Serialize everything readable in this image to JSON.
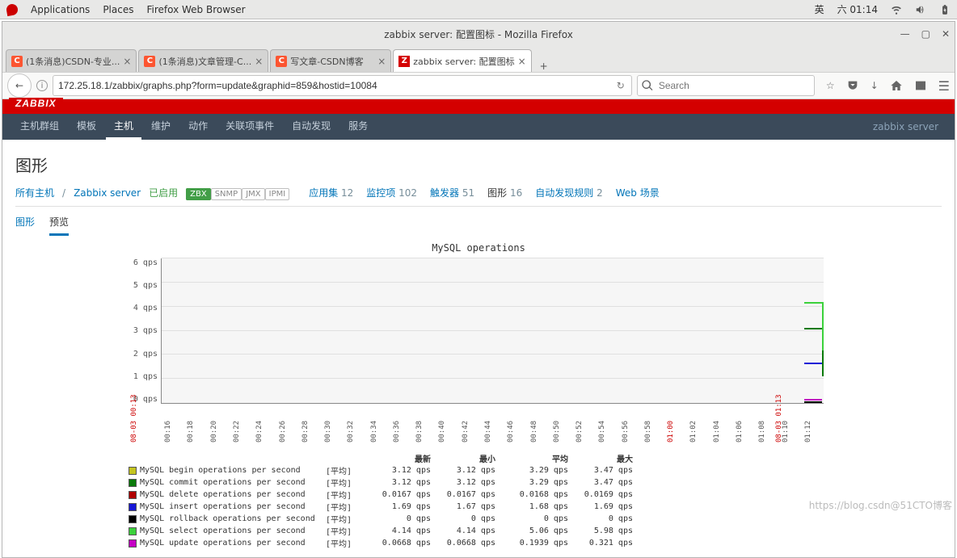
{
  "gnome": {
    "apps": "Applications",
    "places": "Places",
    "browser": "Firefox Web Browser",
    "lang": "英",
    "date": "六 01:14"
  },
  "firefox": {
    "title": "zabbix server: 配置图标 - Mozilla Firefox",
    "url": "172.25.18.1/zabbix/graphs.php?form=update&graphid=859&hostid=10084",
    "search_placeholder": "Search",
    "tabs": [
      {
        "label": "(1条消息)CSDN-专业...",
        "icon": "csdn"
      },
      {
        "label": "(1条消息)文章管理-C...",
        "icon": "csdn"
      },
      {
        "label": "写文章-CSDN博客",
        "icon": "csdn"
      },
      {
        "label": "zabbix server: 配置图标",
        "icon": "zbx",
        "active": true
      }
    ]
  },
  "zabbix": {
    "logo": "ZABBIX",
    "server_name": "zabbix server",
    "nav": [
      {
        "label": "主机群组"
      },
      {
        "label": "模板"
      },
      {
        "label": "主机",
        "active": true
      },
      {
        "label": "维护"
      },
      {
        "label": "动作"
      },
      {
        "label": "关联项事件"
      },
      {
        "label": "自动发现"
      },
      {
        "label": "服务"
      }
    ],
    "title": "图形",
    "breadcrumb": {
      "all_hosts": "所有主机",
      "host": "Zabbix server",
      "enabled": "已启用",
      "badges": [
        {
          "label": "ZBX",
          "on": true
        },
        {
          "label": "SNMP"
        },
        {
          "label": "JMX"
        },
        {
          "label": "IPMI"
        }
      ],
      "links": [
        {
          "label": "应用集",
          "count": 12
        },
        {
          "label": "监控项",
          "count": 102
        },
        {
          "label": "触发器",
          "count": 51
        },
        {
          "label": "图形",
          "count": 16,
          "active": true
        },
        {
          "label": "自动发现规则",
          "count": 2
        },
        {
          "label": "Web 场景",
          "count": ""
        }
      ]
    },
    "tabs": [
      {
        "label": "图形"
      },
      {
        "label": "预览",
        "active": true
      }
    ]
  },
  "chart_data": {
    "type": "line",
    "title": "MySQL operations",
    "ylabel_suffix": "qps",
    "ylim": [
      0,
      6
    ],
    "yticks": [
      0,
      1,
      2,
      3,
      4,
      5,
      6
    ],
    "x_date_left": "08-03 00:13",
    "x_date_right": "08-03 01:13",
    "xticks": [
      "00:16",
      "00:18",
      "00:20",
      "00:22",
      "00:24",
      "00:26",
      "00:28",
      "00:30",
      "00:32",
      "00:34",
      "00:36",
      "00:38",
      "00:40",
      "00:42",
      "00:44",
      "00:46",
      "00:48",
      "00:50",
      "00:52",
      "00:54",
      "00:56",
      "00:58",
      "01:00",
      "01:02",
      "01:04",
      "01:06",
      "01:08",
      "01:10",
      "01:12"
    ],
    "xticks_red": [
      "01:00"
    ],
    "legend_headers": [
      "最新",
      "最小",
      "平均",
      "最大"
    ],
    "agg_label": "[平均]",
    "series": [
      {
        "name": "MySQL begin operations per second",
        "color": "#c4c41f",
        "last": "3.12 qps",
        "min": "3.12 qps",
        "avg": "3.29 qps",
        "max": "3.47 qps",
        "line_top_pct": 48
      },
      {
        "name": "MySQL commit operations per second",
        "color": "#0a7a0a",
        "last": "3.12 qps",
        "min": "3.12 qps",
        "avg": "3.29 qps",
        "max": "3.47 qps",
        "line_top_pct": 48,
        "drop": true
      },
      {
        "name": "MySQL delete operations per second",
        "color": "#b00000",
        "last": "0.0167 qps",
        "min": "0.0167 qps",
        "avg": "0.0168 qps",
        "max": "0.0169 qps",
        "line_top_pct": 99
      },
      {
        "name": "MySQL insert operations per second",
        "color": "#1717d6",
        "last": "1.69 qps",
        "min": "1.67 qps",
        "avg": "1.68 qps",
        "max": "1.69 qps",
        "line_top_pct": 72
      },
      {
        "name": "MySQL rollback operations per second",
        "color": "#000000",
        "last": "0 qps",
        "min": "0 qps",
        "avg": "0 qps",
        "max": "0 qps",
        "line_top_pct": 99
      },
      {
        "name": "MySQL select operations per second",
        "color": "#3bd13b",
        "last": "4.14 qps",
        "min": "4.14 qps",
        "avg": "5.06 qps",
        "max": "5.98 qps",
        "line_top_pct": 30,
        "drop": true
      },
      {
        "name": "MySQL update operations per second",
        "color": "#c400c4",
        "last": "0.0668 qps",
        "min": "0.0668 qps",
        "avg": "0.1939 qps",
        "max": "0.321 qps",
        "line_top_pct": 97
      }
    ]
  },
  "watermark": "https://blog.csdn@51CTO博客"
}
